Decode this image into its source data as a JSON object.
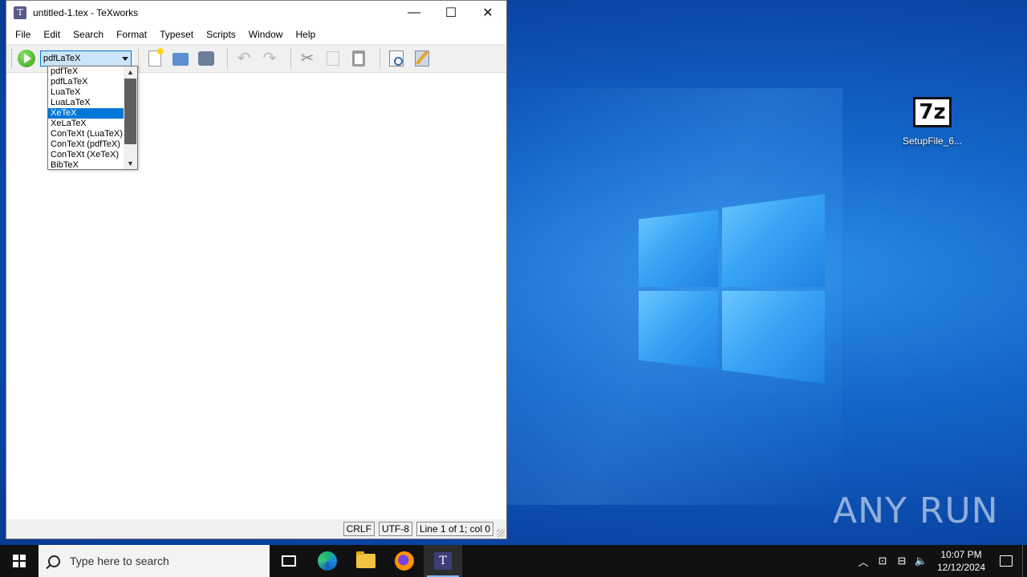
{
  "desktop": {
    "icon_label": "SetupFile_6...",
    "icon_glyph": "7z",
    "watermark": "ANY RUN"
  },
  "window": {
    "title": "untitled-1.tex - TeXworks",
    "controls": {
      "minimize": "—",
      "maximize": "☐",
      "close": "✕"
    }
  },
  "menubar": {
    "items": [
      "File",
      "Edit",
      "Search",
      "Format",
      "Typeset",
      "Scripts",
      "Window",
      "Help"
    ]
  },
  "toolbar": {
    "engine_selected": "pdfLaTeX",
    "icons": [
      "typeset-run-icon",
      "new-file-icon",
      "open-file-icon",
      "save-file-icon",
      "undo-icon",
      "redo-icon",
      "cut-icon",
      "copy-icon",
      "paste-icon",
      "preview-icon",
      "settings-icon"
    ]
  },
  "engine_dropdown": {
    "options": [
      "pdfTeX",
      "pdfLaTeX",
      "LuaTeX",
      "LuaLaTeX",
      "XeTeX",
      "XeLaTeX",
      "ConTeXt (LuaTeX)",
      "ConTeXt (pdfTeX)",
      "ConTeXt (XeTeX)",
      "BibTeX"
    ],
    "highlighted": "XeTeX"
  },
  "statusbar": {
    "line_ending": "CRLF",
    "encoding": "UTF-8",
    "position": "Line 1 of 1; col 0"
  },
  "taskbar": {
    "search_placeholder": "Type here to search",
    "time": "10:07 PM",
    "date": "12/12/2024"
  },
  "colors": {
    "accent": "#0078d7",
    "desktop": "#1466c9",
    "taskbar": "#111111"
  }
}
